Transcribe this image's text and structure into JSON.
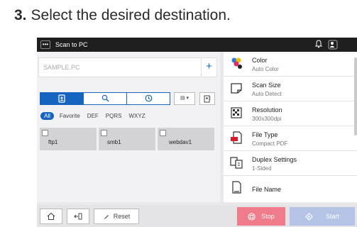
{
  "instruction": {
    "number": "3.",
    "text": "Select the desired destination."
  },
  "window": {
    "menu_glyph": "•••",
    "title": "Scan to PC"
  },
  "titlebar_icons": {
    "bell": "🔔",
    "user": "⚙"
  },
  "search": {
    "placeholder": "SAMPLE.PC",
    "add_label": "+"
  },
  "tabs": [
    {
      "name": "address-book-icon",
      "glyph": "▦"
    },
    {
      "name": "search-icon",
      "glyph": "⌕"
    },
    {
      "name": "history-icon",
      "glyph": "◷"
    }
  ],
  "view_toggle": "▤ ▾",
  "addr_button": "▤",
  "filters": {
    "all": "All",
    "items": [
      "Favorite",
      "DEF",
      "PQRS",
      "WXYZ"
    ]
  },
  "destinations": [
    "ftp1",
    "smb1",
    "webdav1"
  ],
  "settings": [
    {
      "label": "Color",
      "value": "Auto Color"
    },
    {
      "label": "Scan Size",
      "value": "Auto Detect"
    },
    {
      "label": "Resolution",
      "value": "300x300dpi"
    },
    {
      "label": "File Type",
      "value": "Compact PDF"
    },
    {
      "label": "Duplex Settings",
      "value": "1-Sided"
    },
    {
      "label": "File Name",
      "value": ""
    }
  ],
  "bottom": {
    "home": "⌂",
    "exit": "⇤",
    "reset": "Reset",
    "stop": "Stop",
    "start": "Start"
  },
  "colors": {
    "accent": "#1565c0",
    "stop": "#ef7b8b",
    "start": "#b5c4e6",
    "titlebar": "#1f1f1f"
  }
}
